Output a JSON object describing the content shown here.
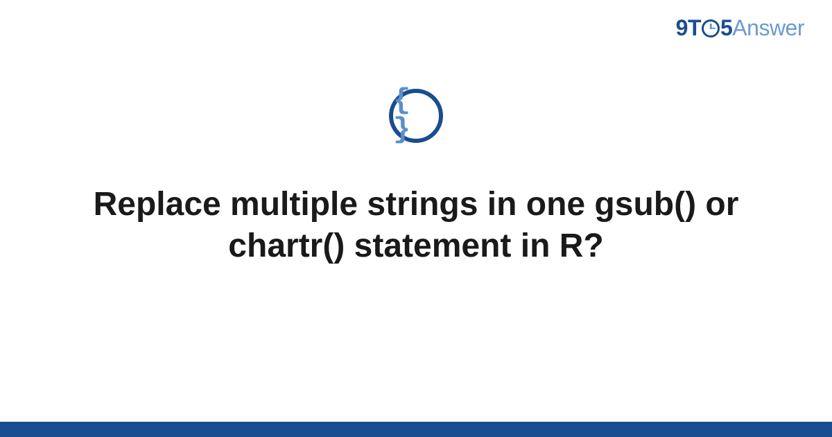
{
  "logo": {
    "prefix": "9T",
    "suffix": "5",
    "word": "Answer"
  },
  "icon": {
    "content": "{ }",
    "name": "code-braces"
  },
  "title": "Replace multiple strings in one gsub() or chartr() statement in R?",
  "colors": {
    "primary": "#1a4d8f",
    "secondary": "#6b9bd1",
    "text": "#1a1a1a"
  }
}
